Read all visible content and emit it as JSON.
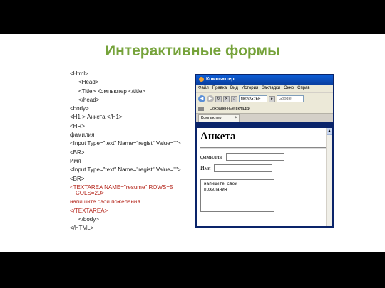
{
  "slide": {
    "title": "Интерактивные формы",
    "code_lines": [
      "<Html>",
      "<Head>",
      "<Title> Компьютер </title>",
      "</head>",
      "<body>",
      "<H1 > Анкета </H1>",
      "<HR>",
      "фамилия",
      "<Input Type=\"text\" Name=\"regist\" Value=\"\">",
      "<BR>",
      "Имя",
      "<Input Type=\"text\" Name=\"regist\" Value=\"\">",
      "<BR>",
      "<TEXTAREA NAME=\"resume\" ROWS=5",
      "COLS=20>",
      "напишите свои пожелания",
      "</TEXTAREA>",
      "</body>",
      "</HTML>"
    ]
  },
  "browser": {
    "window_title": "Компьютер",
    "menu": [
      "Файл",
      "Правка",
      "Вид",
      "История",
      "Закладки",
      "Окно",
      "Справ"
    ],
    "address": "file:///G:/EF",
    "search_placeholder": "Google",
    "bookmarks_label": "Сохраненные вкладки",
    "tab_label": "Компьютер",
    "page": {
      "heading": "Анкета",
      "label_surname": "фамилия",
      "label_name": "Имя",
      "textarea_value": "напишите свои\nпожелания"
    }
  }
}
